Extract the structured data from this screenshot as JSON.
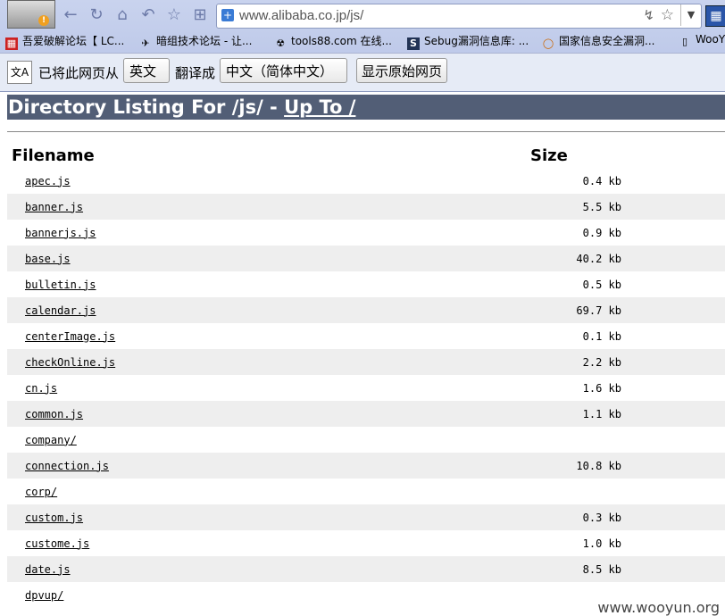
{
  "browser": {
    "url": "www.alibaba.co.jp/js/",
    "bookmarks": [
      {
        "label": "吾爱破解论坛【 LC...",
        "icon": "forum-icon"
      },
      {
        "label": "暗组技术论坛 - 让...",
        "icon": "plane-icon"
      },
      {
        "label": "tools88.com 在线...",
        "icon": "radiation-icon"
      },
      {
        "label": "Sebug漏洞信息库: ...",
        "icon": "s-icon"
      },
      {
        "label": "国家信息安全漏洞...",
        "icon": "globe-icon"
      },
      {
        "label": "WooY",
        "icon": "page-icon"
      }
    ]
  },
  "translate_bar": {
    "prefix": "已将此网页从",
    "from_lang": "英文",
    "middle": "翻译成",
    "to_lang": "中文（简体中文）",
    "show_original": "显示原始网页"
  },
  "listing": {
    "title_prefix": "Directory Listing For /js/ - ",
    "up_link": "Up To /",
    "col_filename": "Filename",
    "col_size": "Size",
    "rows": [
      {
        "name": "apec.js",
        "size": "0.4 kb"
      },
      {
        "name": "banner.js",
        "size": "5.5 kb"
      },
      {
        "name": "bannerjs.js",
        "size": "0.9 kb"
      },
      {
        "name": "base.js",
        "size": "40.2 kb"
      },
      {
        "name": "bulletin.js",
        "size": "0.5 kb"
      },
      {
        "name": "calendar.js",
        "size": "69.7 kb"
      },
      {
        "name": "centerImage.js",
        "size": "0.1 kb"
      },
      {
        "name": "checkOnline.js",
        "size": "2.2 kb"
      },
      {
        "name": "cn.js",
        "size": "1.6 kb"
      },
      {
        "name": "common.js",
        "size": "1.1 kb"
      },
      {
        "name": "company/",
        "size": ""
      },
      {
        "name": "connection.js",
        "size": "10.8 kb"
      },
      {
        "name": "corp/",
        "size": ""
      },
      {
        "name": "custom.js",
        "size": "0.3 kb"
      },
      {
        "name": "custome.js",
        "size": "1.0 kb"
      },
      {
        "name": "date.js",
        "size": "8.5 kb"
      },
      {
        "name": "dpvup/",
        "size": ""
      }
    ]
  },
  "watermark": "www.wooyun.org"
}
